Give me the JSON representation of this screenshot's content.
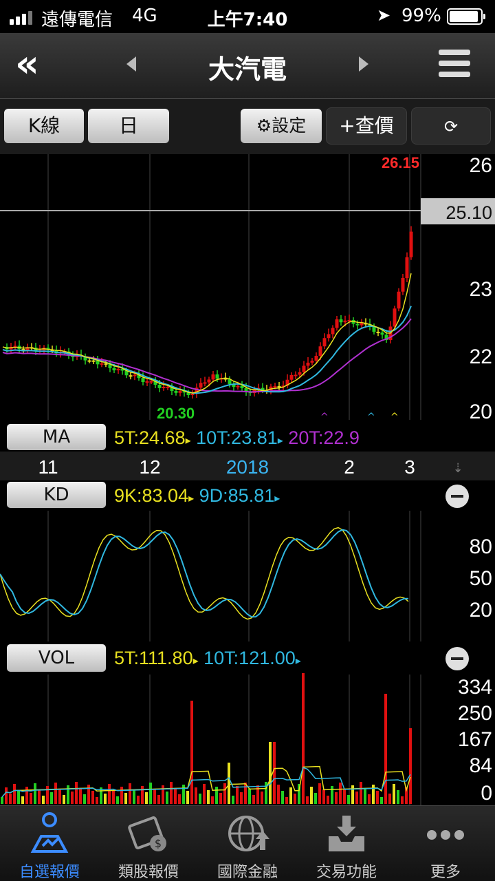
{
  "status_bar": {
    "carrier": "遠傳電信",
    "network": "4G",
    "time": "上午7:40",
    "battery": "99%"
  },
  "nav": {
    "title": "大汽電",
    "back_icon": "double-chevron-left-icon",
    "menu_icon": "hamburger-menu-icon"
  },
  "toolbar": {
    "chart_type": "K線",
    "period": "日",
    "settings": "設定",
    "quote": "查價",
    "rotate_icon": "rotate-screen-icon"
  },
  "main_panel": {
    "price_labels": [
      "26",
      "25",
      "23",
      "22",
      "20"
    ],
    "current_price": "25.10",
    "high_marker": "26.15",
    "low_marker": "20.30",
    "ma_button": "MA",
    "ma5": "5T:24.68",
    "ma10": "10T:23.81",
    "ma20": "20T:22.9",
    "date_labels": [
      "11",
      "12",
      "2018",
      "2",
      "3"
    ]
  },
  "kd_panel": {
    "button": "KD",
    "k": "9K:83.04",
    "d": "9D:85.81",
    "levels": [
      "80",
      "50",
      "20"
    ]
  },
  "vol_panel": {
    "button": "VOL",
    "ma5": "5T:111.80",
    "ma10": "10T:121.00",
    "levels": [
      "334",
      "250",
      "167",
      "84",
      "0"
    ]
  },
  "tabs": [
    {
      "label": "自選報價",
      "icon": "person-chart-icon",
      "active": true
    },
    {
      "label": "類股報價",
      "icon": "film-coin-icon",
      "active": false
    },
    {
      "label": "國際金融",
      "icon": "globe-icon",
      "active": false
    },
    {
      "label": "交易功能",
      "icon": "download-tray-icon",
      "active": false
    },
    {
      "label": "更多",
      "icon": "more-dots-icon",
      "active": false
    }
  ],
  "colors": {
    "up": "#e01010",
    "down": "#22d022",
    "ma5": "#e8e020",
    "ma10": "#30b8e0",
    "ma20": "#b030d0",
    "active_tab": "#3c8cff"
  },
  "chart_data": {
    "type": "candlestick",
    "price_axis_labels": [
      26,
      25,
      23,
      22,
      20
    ],
    "current_price": 25.1,
    "high": 26.15,
    "low": 20.3,
    "ma": {
      "5T": 24.68,
      "10T": 23.81,
      "20T": 22.9
    },
    "kd": {
      "9K": 83.04,
      "9D": 85.81,
      "levels": [
        80,
        50,
        20
      ]
    },
    "volume": {
      "5T": 111.8,
      "10T": 121.0,
      "axis": [
        334,
        250,
        167,
        84,
        0
      ]
    },
    "x_labels": [
      "11",
      "12",
      "2018",
      "2",
      "3"
    ]
  }
}
